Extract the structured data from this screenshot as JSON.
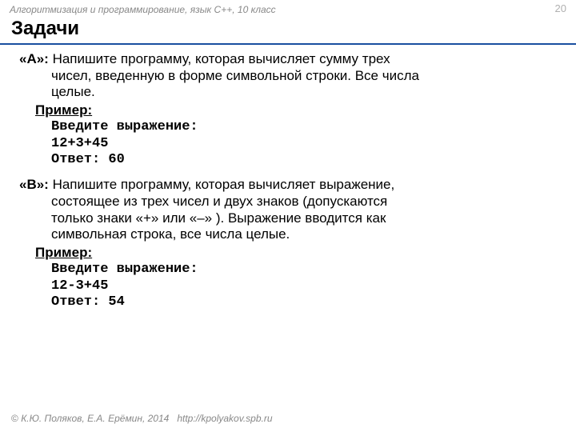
{
  "header": {
    "subject": "Алгоритмизация и программирование, язык C++, 10 класс",
    "page_number": "20"
  },
  "title": "Задачи",
  "tasks": [
    {
      "label": "«A»: ",
      "line1": "Напишите программу, которая вычисляет сумму трех",
      "line2": "чисел, введенную в форме символьной строки. Все числа",
      "line3": "целые.",
      "primer_label": "Пример:",
      "code": "Введите выражение:\n12+3+45\nОтвет: 60"
    },
    {
      "label": "«B»: ",
      "line1": "Напишите программу, которая вычисляет выражение,",
      "line2": "состоящее из трех чисел и двух знаков (допускаются",
      "line3": "только знаки «+» или «–» ). Выражение вводится как",
      "line4": "символьная строка, все числа целые.",
      "primer_label": "Пример:",
      "code": "Введите выражение:\n12-3+45\nОтвет: 54"
    }
  ],
  "footer": {
    "copyright": "© ",
    "authors": "К.Ю. Поляков, Е.А. Ерёмин, 2014",
    "url": "http://kpolyakov.spb.ru"
  }
}
